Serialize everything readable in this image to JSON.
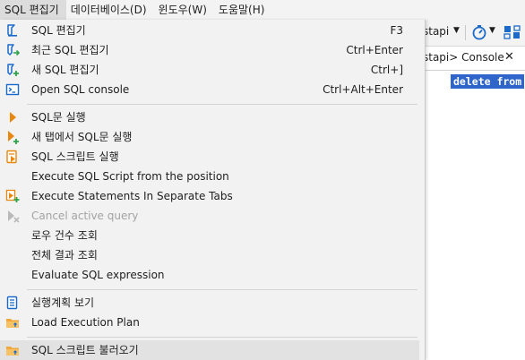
{
  "menubar": {
    "items": [
      {
        "label": "SQL 편집기",
        "active": true
      },
      {
        "label": "데이터베이스(D)"
      },
      {
        "label": "윈도우(W)"
      },
      {
        "label": "도움말(H)"
      }
    ]
  },
  "toolbar": {
    "connection_label": "stapi"
  },
  "editor_tab": {
    "label": "stapi> Console"
  },
  "editor": {
    "code": "delete from"
  },
  "menu": {
    "items": [
      {
        "label": "SQL 편집기",
        "shortcut": "F3",
        "icon": "sql-editor-icon"
      },
      {
        "label": "최근 SQL 편집기",
        "shortcut": "Ctrl+Enter",
        "icon": "recent-sql-editor-icon"
      },
      {
        "label": "새 SQL 편집기",
        "shortcut": "Ctrl+]",
        "icon": "new-sql-editor-icon"
      },
      {
        "label": "Open SQL console",
        "shortcut": "Ctrl+Alt+Enter",
        "icon": "console-icon"
      },
      {
        "label": "SQL문 실행",
        "icon": "execute-icon"
      },
      {
        "label": "새 탭에서 SQL문 실행",
        "icon": "execute-new-tab-icon"
      },
      {
        "label": "SQL 스크립트 실행",
        "icon": "execute-script-icon"
      },
      {
        "label": "Execute SQL Script from the position"
      },
      {
        "label": "Execute Statements In Separate Tabs",
        "icon": "execute-separate-tabs-icon"
      },
      {
        "label": "Cancel active query",
        "icon": "cancel-query-icon",
        "disabled": true
      },
      {
        "label": "로우 건수 조회"
      },
      {
        "label": "전체 결과 조회"
      },
      {
        "label": "Evaluate SQL expression"
      },
      {
        "label": "실행계획 보기",
        "icon": "execution-plan-icon"
      },
      {
        "label": "Load Execution Plan",
        "icon": "load-plan-folder-icon"
      },
      {
        "label": "SQL 스크립트 불러오기",
        "icon": "load-script-folder-icon"
      }
    ]
  },
  "colors": {
    "menu_bg": "#f2f2f2",
    "hover_bg": "#e2e2e2",
    "accent_blue": "#1b6ac9",
    "selection": "#2f65ca",
    "arrow_orange": "#e8870e"
  }
}
